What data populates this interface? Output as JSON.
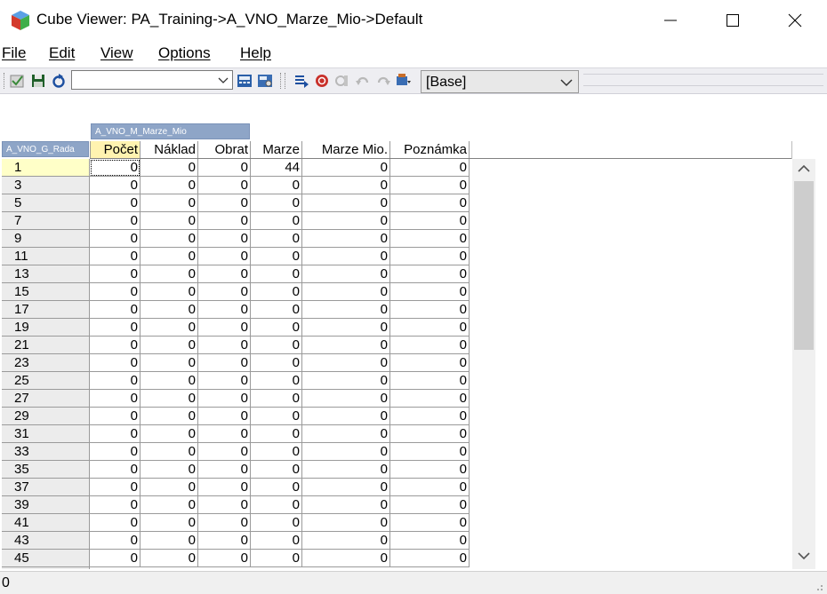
{
  "window": {
    "title": "Cube Viewer: PA_Training->A_VNO_Marze_Mio->Default",
    "icons": [
      "cube-app-icon",
      "minimize-icon",
      "maximize-icon",
      "close-icon"
    ]
  },
  "menu": {
    "items": [
      {
        "label": "File"
      },
      {
        "label": "Edit"
      },
      {
        "label": "View"
      },
      {
        "label": "Options"
      },
      {
        "label": "Help"
      }
    ]
  },
  "toolbar": {
    "subset_combo_value": "",
    "view_combo_value": "[Base]",
    "icons": [
      "check-icon",
      "save-icon",
      "recalculate-icon",
      "dropdown-arrow-icon",
      "calculator-icon",
      "calculator-settings-icon",
      "export-icon",
      "stop-icon",
      "sandbox-icon",
      "undo-icon",
      "redo-icon",
      "commit-icon"
    ]
  },
  "grid": {
    "column_dimension": "A_VNO_M_Marze_Mio",
    "row_dimension": "A_VNO_G_Rada",
    "columns": [
      "Počet",
      "Náklad",
      "Obrat",
      "Marze",
      "Marze  Mio.",
      "Poznámka"
    ],
    "rows": [
      {
        "label": "1",
        "values": [
          "0",
          "0",
          "0",
          "44",
          "0",
          "0"
        ]
      },
      {
        "label": "3",
        "values": [
          "0",
          "0",
          "0",
          "0",
          "0",
          "0"
        ]
      },
      {
        "label": "5",
        "values": [
          "0",
          "0",
          "0",
          "0",
          "0",
          "0"
        ]
      },
      {
        "label": "7",
        "values": [
          "0",
          "0",
          "0",
          "0",
          "0",
          "0"
        ]
      },
      {
        "label": "9",
        "values": [
          "0",
          "0",
          "0",
          "0",
          "0",
          "0"
        ]
      },
      {
        "label": "11",
        "values": [
          "0",
          "0",
          "0",
          "0",
          "0",
          "0"
        ]
      },
      {
        "label": "13",
        "values": [
          "0",
          "0",
          "0",
          "0",
          "0",
          "0"
        ]
      },
      {
        "label": "15",
        "values": [
          "0",
          "0",
          "0",
          "0",
          "0",
          "0"
        ]
      },
      {
        "label": "17",
        "values": [
          "0",
          "0",
          "0",
          "0",
          "0",
          "0"
        ]
      },
      {
        "label": "19",
        "values": [
          "0",
          "0",
          "0",
          "0",
          "0",
          "0"
        ]
      },
      {
        "label": "21",
        "values": [
          "0",
          "0",
          "0",
          "0",
          "0",
          "0"
        ]
      },
      {
        "label": "23",
        "values": [
          "0",
          "0",
          "0",
          "0",
          "0",
          "0"
        ]
      },
      {
        "label": "25",
        "values": [
          "0",
          "0",
          "0",
          "0",
          "0",
          "0"
        ]
      },
      {
        "label": "27",
        "values": [
          "0",
          "0",
          "0",
          "0",
          "0",
          "0"
        ]
      },
      {
        "label": "29",
        "values": [
          "0",
          "0",
          "0",
          "0",
          "0",
          "0"
        ]
      },
      {
        "label": "31",
        "values": [
          "0",
          "0",
          "0",
          "0",
          "0",
          "0"
        ]
      },
      {
        "label": "33",
        "values": [
          "0",
          "0",
          "0",
          "0",
          "0",
          "0"
        ]
      },
      {
        "label": "35",
        "values": [
          "0",
          "0",
          "0",
          "0",
          "0",
          "0"
        ]
      },
      {
        "label": "37",
        "values": [
          "0",
          "0",
          "0",
          "0",
          "0",
          "0"
        ]
      },
      {
        "label": "39",
        "values": [
          "0",
          "0",
          "0",
          "0",
          "0",
          "0"
        ]
      },
      {
        "label": "41",
        "values": [
          "0",
          "0",
          "0",
          "0",
          "0",
          "0"
        ]
      },
      {
        "label": "43",
        "values": [
          "0",
          "0",
          "0",
          "0",
          "0",
          "0"
        ]
      },
      {
        "label": "45",
        "values": [
          "0",
          "0",
          "0",
          "0",
          "0",
          "0"
        ]
      }
    ]
  },
  "status": {
    "text": "0"
  },
  "colors": {
    "dimension_label_bg": "#8ea5c7",
    "header_highlight": "#fff3b0",
    "row_highlight": "#ffffc8"
  }
}
